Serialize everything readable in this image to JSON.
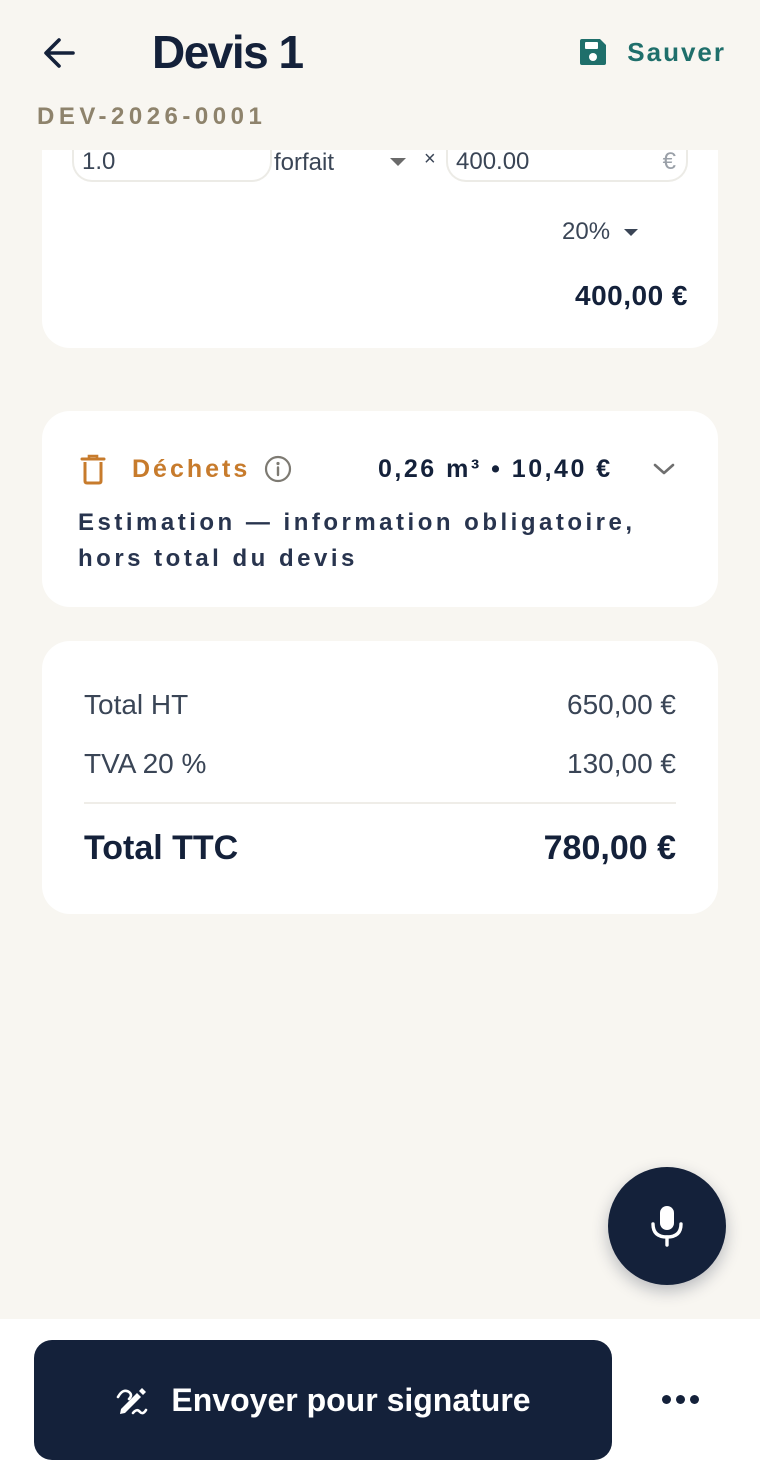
{
  "header": {
    "title": "Devis 1",
    "save_label": "Sauver",
    "reference": "DEV-2026-0001"
  },
  "line_item": {
    "quantity": "1.0",
    "unit": "forfait",
    "times_symbol": "×",
    "unit_price": "400.00",
    "currency_symbol": "€",
    "vat_rate": "20%",
    "line_total": "400,00 €"
  },
  "waste": {
    "title": "Déchets",
    "amount": "0,26 m³ • 10,40 €",
    "note": "Estimation — information obligatoire, hors total du devis"
  },
  "totals": {
    "ht_label": "Total HT",
    "ht_value": "650,00 €",
    "tva_label": "TVA 20 %",
    "tva_value": "130,00 €",
    "ttc_label": "Total TTC",
    "ttc_value": "780,00 €"
  },
  "footer": {
    "send_label": "Envoyer pour signature"
  },
  "colors": {
    "background": "#f8f6f1",
    "navy": "#14213a",
    "teal": "#1f6f6b",
    "amber": "#c77b2c",
    "reference": "#8e836c"
  },
  "icons": {
    "back": "arrow-left-icon",
    "save": "floppy-disk-icon",
    "waste": "trash-icon",
    "info": "info-icon",
    "expand": "chevron-down-icon",
    "mic": "microphone-icon",
    "send": "signature-pen-icon",
    "more": "more-horizontal-icon"
  }
}
